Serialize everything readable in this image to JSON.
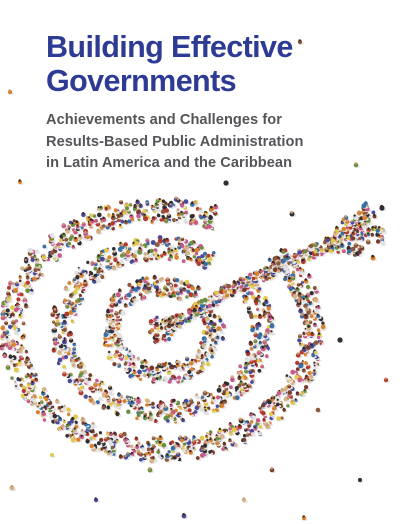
{
  "cover": {
    "title_lines": [
      "Building Effective",
      "Governments"
    ],
    "subtitle_lines": [
      "Achievements and Challenges for",
      "Results-Based Public Administration",
      "in Latin America and the Caribbean"
    ]
  },
  "colors": {
    "title": "#2d3b95",
    "subtitle": "#555559",
    "background": "#ffffff",
    "people": [
      "#b23a2e",
      "#d9822b",
      "#3a6ea5",
      "#2f2f35",
      "#e2c84b",
      "#6a8f3f",
      "#8b5a3c",
      "#c85a8a",
      "#4a4a9a",
      "#e0e0e0",
      "#7a3b2a",
      "#d6b48a"
    ]
  },
  "illustration": {
    "subject": "crowd of people forming a target with an arrow",
    "icon": "target-arrow-crowd"
  }
}
